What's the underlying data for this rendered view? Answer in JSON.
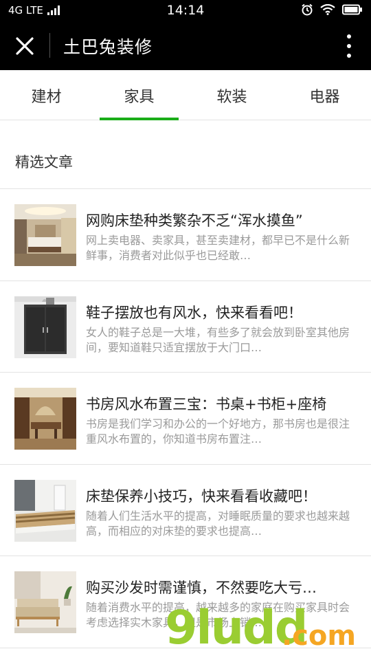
{
  "status_bar": {
    "network": "4G LTE",
    "time": "14:14"
  },
  "header": {
    "title": "土巴兔装修"
  },
  "tabs": [
    {
      "label": "建材",
      "active": false
    },
    {
      "label": "家具",
      "active": true
    },
    {
      "label": "软装",
      "active": false
    },
    {
      "label": "电器",
      "active": false
    }
  ],
  "section": {
    "title": "精选文章"
  },
  "articles": [
    {
      "title": "网购床垫种类繁杂不乏“浑水摸鱼”",
      "summary": "网上卖电器、卖家具，甚至卖建材，都早已不是什么新鲜事，消费者对此似乎也已经敢…",
      "thumb": "bedroom-image"
    },
    {
      "title": "鞋子摆放也有风水，快来看看吧！",
      "summary": "女人的鞋子总是一大堆，有些多了就会放到卧室其他房间，要知道鞋只适宜摆放于大门口…",
      "thumb": "shoe-cabinet-image"
    },
    {
      "title": "书房风水布置三宝：书桌+书柜+座椅",
      "summary": "书房是我们学习和办公的一个好地方，那书房也是很注重风水布置的，你知道书房布置注…",
      "thumb": "study-room-image"
    },
    {
      "title": "床垫保养小技巧，快来看看收藏吧！",
      "summary": "随着人们生活水平的提高，对睡眠质量的要求也越来越高，而相应的对床垫的要求也提高…",
      "thumb": "mattress-image"
    },
    {
      "title": "购买沙发时需谨慎，不然要吃大亏…",
      "summary": "随着消费水平的提高，越来越多的家庭在购买家具时会考虑选择实木家具，但是市场上销…",
      "thumb": "sofa-image"
    }
  ],
  "watermark": {
    "main": "9ludd",
    "suffix": ".com"
  },
  "colors": {
    "accent": "#1aad19",
    "header_bg": "#000000",
    "summary_text": "#9a9a9a"
  }
}
